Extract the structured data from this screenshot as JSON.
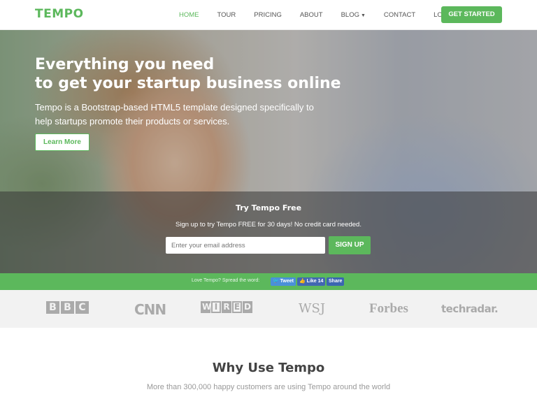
{
  "brand": {
    "name": "TEMPO",
    "accent": "#5cb85c"
  },
  "nav": {
    "items": [
      {
        "label": "HOME",
        "active": true
      },
      {
        "label": "TOUR"
      },
      {
        "label": "PRICING"
      },
      {
        "label": "ABOUT"
      },
      {
        "label": "BLOG"
      },
      {
        "label": "CONTACT"
      },
      {
        "label": "LOG IN"
      }
    ],
    "blog_caret_icon": "chevron-down-icon",
    "cta": "GET STARTED"
  },
  "hero": {
    "title_line1": "Everything you need",
    "title_line2": "to get your startup business online",
    "subtitle": "Tempo is a Bootstrap-based HTML5 template designed specifically to help startups promote their products or services.",
    "learn_more": "Learn More",
    "signup": {
      "title": "Try Tempo Free",
      "text": "Sign up to try Tempo FREE for 30 days! No credit card needed.",
      "email_placeholder": "Enter your email address",
      "button": "SIGN UP"
    }
  },
  "share": {
    "text": "Love Tempo? Spread the word:",
    "tweet": "Tweet",
    "like": "Like 14",
    "share": "Share"
  },
  "press_logos": {
    "bbc": [
      "B",
      "B",
      "C"
    ],
    "cnn": "CNN",
    "wired": [
      "W",
      "I",
      "R",
      "E",
      "D"
    ],
    "wsj": "WSJ",
    "forbes": "Forbes",
    "techradar": "techradar."
  },
  "why": {
    "title": "Why Use Tempo",
    "subtitle": "More than 300,000 happy customers are using Tempo around the world"
  }
}
